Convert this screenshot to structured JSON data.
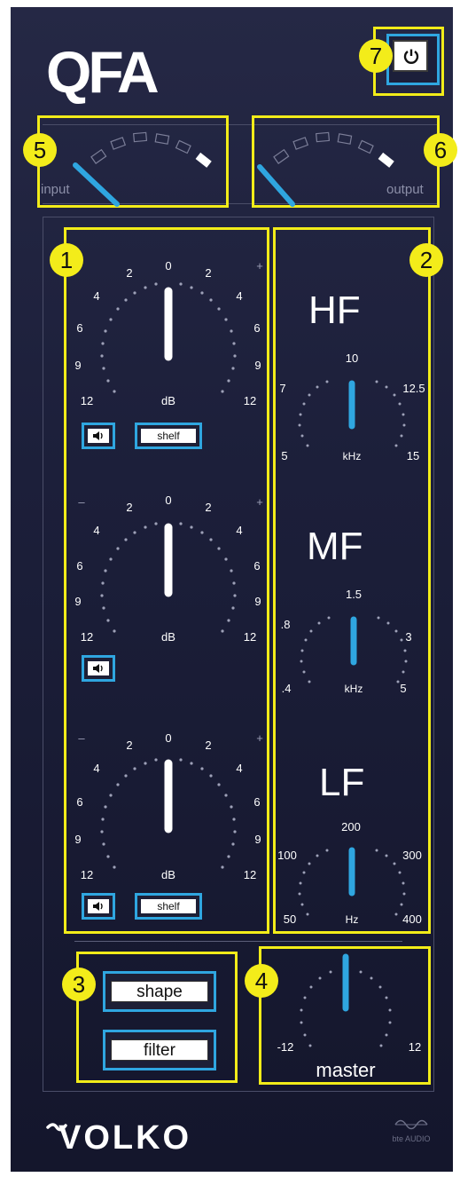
{
  "app": {
    "logo_text": "QFA",
    "brand": "VOLKO",
    "maker_mark": "bte AUDIO",
    "colors": {
      "accent_blue": "#2fa6e0",
      "highlight_yellow": "#f2ec19",
      "bg": "#1c1f3a"
    }
  },
  "annotations": [
    "1",
    "2",
    "3",
    "4",
    "5",
    "6",
    "7"
  ],
  "power": {
    "icon": "power-icon"
  },
  "meters": {
    "input_label": "input",
    "output_label": "output"
  },
  "gain": {
    "scale_left": [
      "2",
      "4",
      "6",
      "9",
      "12"
    ],
    "scale_right": [
      "2",
      "4",
      "6",
      "9",
      "12"
    ],
    "top": "0",
    "unit": "dB",
    "minus": "–",
    "plus": "+",
    "shelf_label": "shelf",
    "solo_icon": "speaker-icon"
  },
  "bands": {
    "hf": {
      "title": "HF",
      "top": "10",
      "left_mid": "7",
      "right_mid": "12.5",
      "left_low": "5",
      "right_low": "15",
      "unit": "kHz"
    },
    "mf": {
      "title": "MF",
      "top": "1.5",
      "left_mid": ".8",
      "right_mid": "3",
      "left_low": ".4",
      "right_low": "5",
      "unit": "kHz"
    },
    "lf": {
      "title": "LF",
      "top": "200",
      "left_mid": "100",
      "right_mid": "300",
      "left_low": "50",
      "right_low": "400",
      "unit": "Hz"
    }
  },
  "modes": {
    "shape_label": "shape",
    "filter_label": "filter"
  },
  "master": {
    "min": "-12",
    "max": "12",
    "label": "master"
  }
}
